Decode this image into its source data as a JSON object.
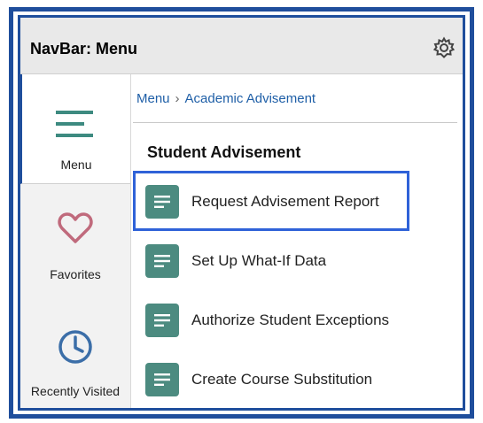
{
  "header": {
    "title": "NavBar: Menu"
  },
  "sidebar": {
    "items": [
      {
        "label": "Menu"
      },
      {
        "label": "Favorites"
      },
      {
        "label": "Recently Visited"
      }
    ]
  },
  "breadcrumb": {
    "items": [
      "Menu",
      "Academic Advisement"
    ]
  },
  "section": {
    "title": "Student Advisement"
  },
  "menu": {
    "items": [
      {
        "label": "Request Advisement Report"
      },
      {
        "label": "Set Up What-If Data"
      },
      {
        "label": "Authorize Student Exceptions"
      },
      {
        "label": "Create Course Substitution"
      }
    ]
  },
  "colors": {
    "frame": "#1f4e9c",
    "tile": "#4c8b80",
    "link": "#1f5fa7",
    "highlight": "#2f62d8",
    "heart": "#c06a7c",
    "clock": "#3b6ea8"
  }
}
